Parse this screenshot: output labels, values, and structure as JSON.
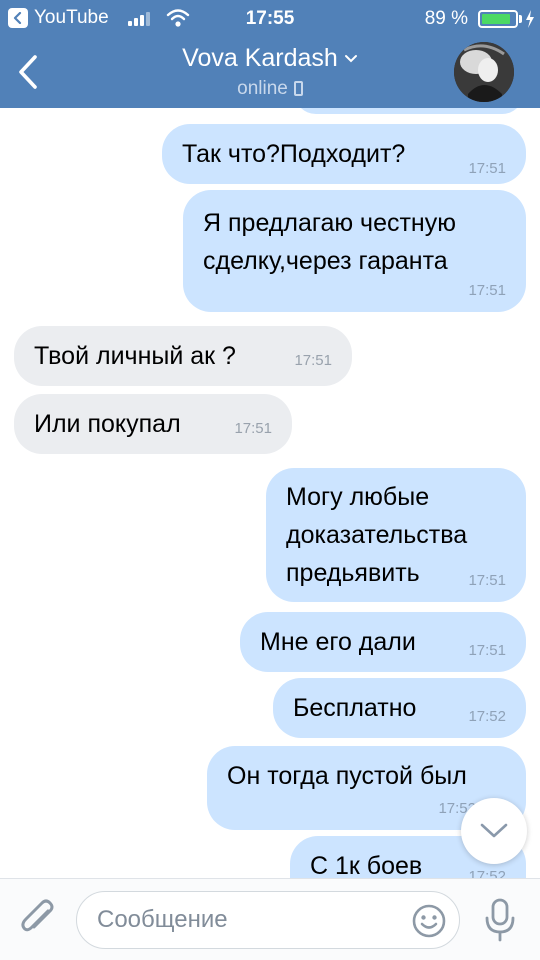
{
  "status_bar": {
    "back_app": "YouTube",
    "time": "17:55",
    "battery": "89 %",
    "battery_level": 0.89
  },
  "header": {
    "name": "Vova Kardash",
    "status": "online"
  },
  "messages": [
    {
      "dir": "out",
      "text": "",
      "time": ""
    },
    {
      "dir": "out",
      "text": "Так что?Подходит?",
      "time": "17:51"
    },
    {
      "dir": "out",
      "text": "Я предлагаю честную\nсделку,через гаранта",
      "time": "17:51"
    },
    {
      "dir": "in",
      "text": "Твой личный ак ?",
      "time": "17:51"
    },
    {
      "dir": "in",
      "text": "Или покупал",
      "time": "17:51"
    },
    {
      "dir": "out",
      "text": "Могу любые\nдоказательства\nпредьявить",
      "time": "17:51"
    },
    {
      "dir": "out",
      "text": "Мне его дали",
      "time": "17:51"
    },
    {
      "dir": "out",
      "text": "Бесплатно",
      "time": "17:52"
    },
    {
      "dir": "out",
      "text": "Он тогда пустой был",
      "time": "17:52"
    },
    {
      "dir": "out",
      "text": "С 1к боев",
      "time": "17:52"
    }
  ],
  "composer": {
    "placeholder": "Сообщение"
  },
  "icons": {
    "back": "chevron-left-icon",
    "attach": "paperclip-icon",
    "emoji": "smile-icon",
    "mic": "microphone-icon",
    "scroll": "chevron-down-icon"
  },
  "colors": {
    "header_bg": "#5181b8",
    "outgoing_bubble": "#cce4ff",
    "incoming_bubble": "#ebedf0",
    "battery_fill": "#4cd964"
  }
}
